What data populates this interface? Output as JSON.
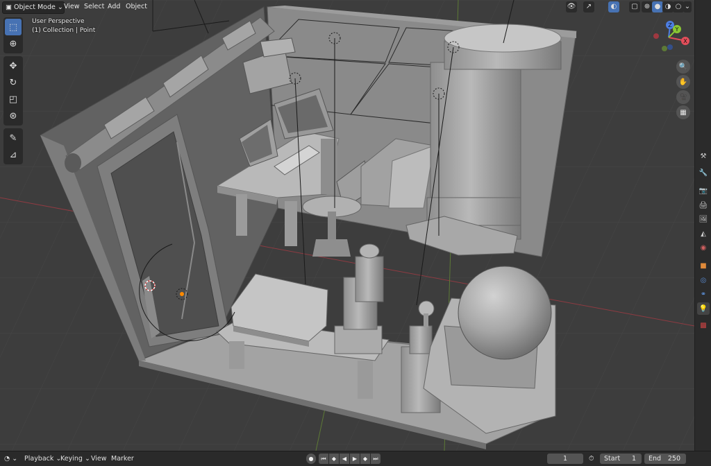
{
  "header": {
    "mode_label": "Object Mode",
    "menus": [
      "View",
      "Select",
      "Add",
      "Object"
    ]
  },
  "viewport": {
    "view_name": "User Perspective",
    "collection_info": "(1) Collection | Point",
    "gizmo": {
      "z": "Z",
      "y": "Y",
      "x": "X"
    }
  },
  "toolbar": {
    "tools": [
      "select-box",
      "cursor",
      "move",
      "rotate",
      "scale",
      "transform",
      "annotate",
      "measure"
    ],
    "active": "select-box"
  },
  "navigation": [
    "zoom",
    "pan",
    "camera",
    "perspective-ortho"
  ],
  "properties_tabs": [
    "tool",
    "render",
    "output",
    "view-layer",
    "scene",
    "world",
    "object",
    "modifiers",
    "physics",
    "object-data-light",
    "texture"
  ],
  "timeline": {
    "playback_label": "Playback",
    "keying_label": "Keying",
    "view_label": "View",
    "marker_label": "Marker",
    "current_frame": "1",
    "start_label": "Start",
    "start_value": "1",
    "end_label": "End",
    "end_value": "250"
  },
  "colors": {
    "accent": "#4772b3",
    "viewport_bg": "#3d3d3d",
    "header_bg": "#282828",
    "x_axis": "#e34e5a",
    "y_axis": "#89c633",
    "z_axis": "#4d7ee3",
    "light_active": "#5fa55f",
    "origin": "#ff8a00"
  }
}
